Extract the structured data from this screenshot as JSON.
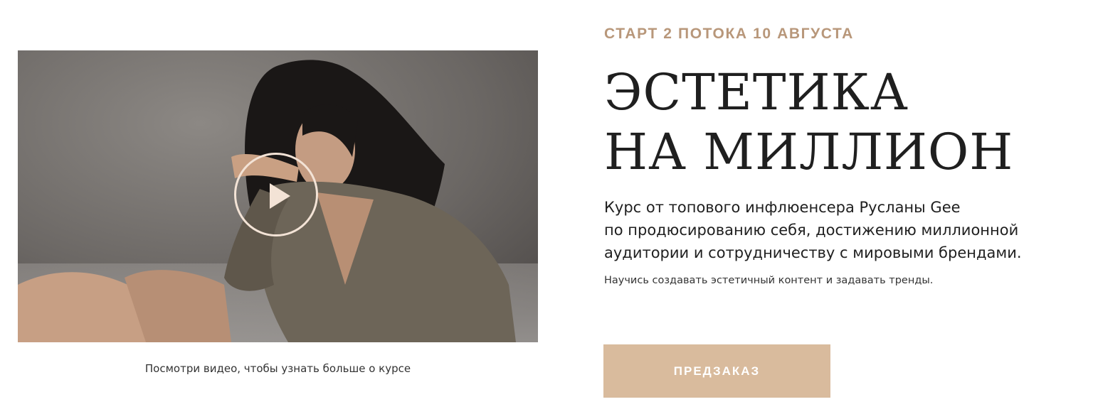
{
  "video": {
    "image_icon": "woman-portrait-image",
    "play_icon": "play-icon",
    "caption": "Посмотри видео, чтобы узнать больше о курсе"
  },
  "hero": {
    "kicker": "СТАРТ 2 ПОТОКА 10 АВГУСТА",
    "title_lines": [
      "ЭСТЕТИКА",
      "НА МИЛЛИОН"
    ],
    "description_lines": [
      "Курс от топового инфлюенсера Русланы Gee",
      "по продюсированию себя, достижению миллионной",
      "аудитории и сотрудничеству с мировыми брендами."
    ],
    "subtext": "Научись создавать эстетичный контент и задавать тренды.",
    "cta_label": "ПРЕДЗАКАЗ"
  },
  "colors": {
    "accent": "#b8977a",
    "button": "#d9bb9d",
    "text": "#1f1f1f",
    "play_ring": "#f3e3d6"
  }
}
